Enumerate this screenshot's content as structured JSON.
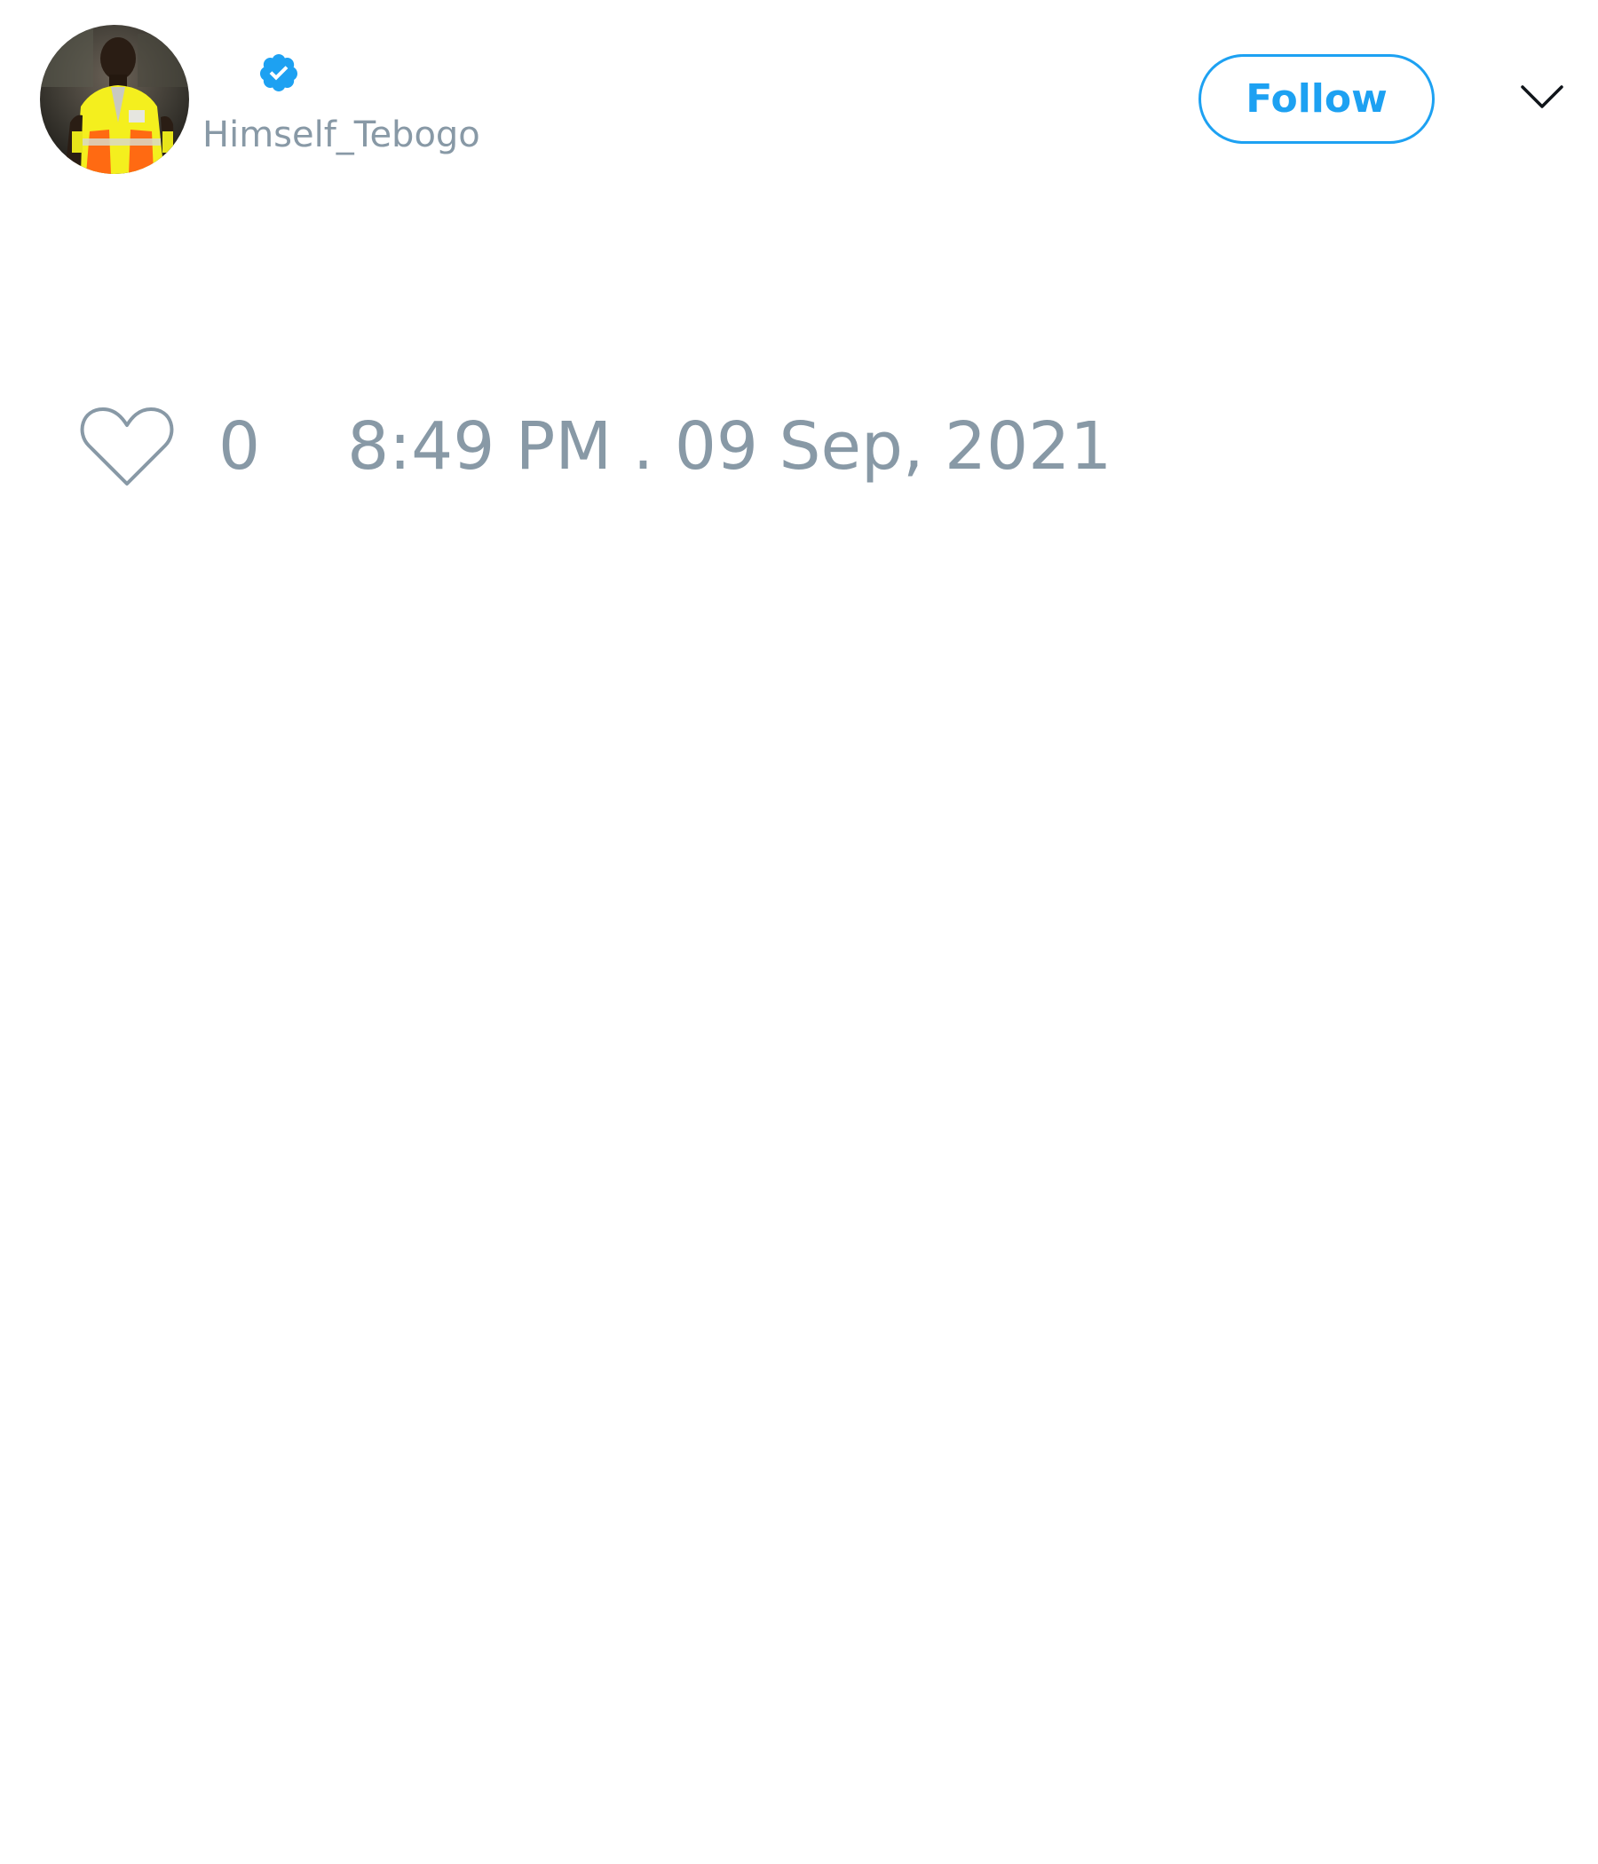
{
  "tweet": {
    "author": {
      "display_name": "",
      "handle": "Himself_Tebogo",
      "verified": true,
      "avatar_icon": "profile-photo"
    },
    "text": "",
    "actions": {
      "like_icon": "heart-outline-icon",
      "like_count": "0",
      "timestamp": "8:49 PM . 09 Sep, 2021"
    },
    "follow_label": "Follow",
    "menu_icon": "chevron-down-icon"
  },
  "colors": {
    "accent": "#1da1f2",
    "secondary_text": "#8899a6",
    "primary_text": "#0f1419",
    "background": "#ffffff"
  }
}
